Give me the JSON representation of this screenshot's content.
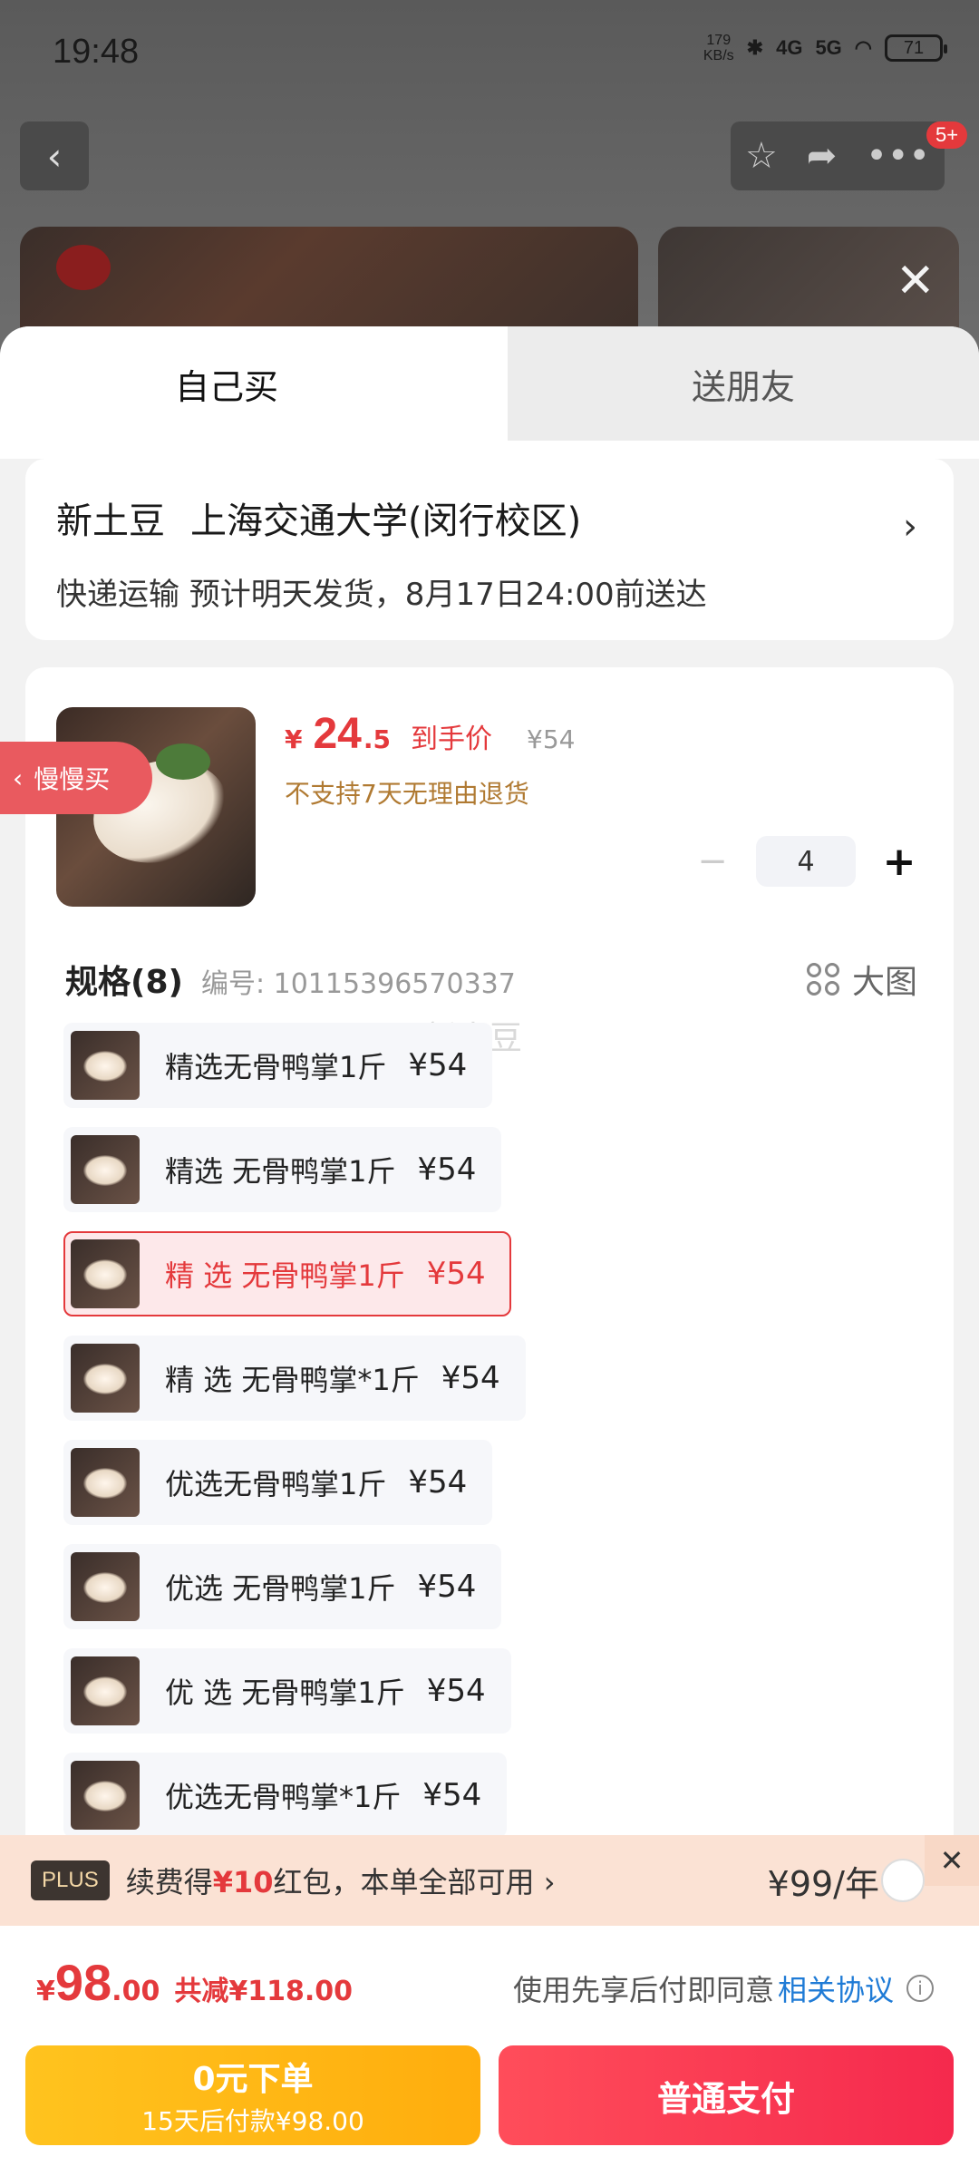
{
  "status": {
    "time": "19:48",
    "net_speed_value": "179",
    "net_speed_unit": "KB/s",
    "sig4g": "4G",
    "sig5g": "5G",
    "battery": "71"
  },
  "topbar": {
    "badge": "5+"
  },
  "tabs": {
    "self": "自己买",
    "friend": "送朋友"
  },
  "address": {
    "name": "新土豆",
    "school": "上海交通大学(闵行校区)",
    "delivery": "快递运输 预计明天发货，8月17日24:00前送达",
    "arrow": "›"
  },
  "product": {
    "price_symbol": "¥",
    "price_int": "24",
    "price_dec": ".5",
    "price_label": "到手价",
    "orig_price": "¥54",
    "notice": "不支持7天无理由退货",
    "qty": "4",
    "qty_minus": "−",
    "qty_plus": "+"
  },
  "side_pill": {
    "label": "慢慢买"
  },
  "spec": {
    "title": "规格(8)",
    "number": "编号: 10115396570337",
    "big_view": "大图",
    "watermark": "新土豆",
    "items": [
      {
        "label": "精选无骨鸭掌1斤",
        "price": "¥54"
      },
      {
        "label": "精选 无骨鸭掌1斤",
        "price": "¥54"
      },
      {
        "label": "精 选 无骨鸭掌1斤",
        "price": "¥54"
      },
      {
        "label": "精 选 无骨鸭掌*1斤",
        "price": "¥54"
      },
      {
        "label": "优选无骨鸭掌1斤",
        "price": "¥54"
      },
      {
        "label": "优选 无骨鸭掌1斤",
        "price": "¥54"
      },
      {
        "label": "优 选 无骨鸭掌1斤",
        "price": "¥54"
      },
      {
        "label": "优选无骨鸭掌*1斤",
        "price": "¥54"
      }
    ]
  },
  "plus": {
    "tag": "PLUS",
    "text_pre": "续费得",
    "amount": "¥10",
    "text_post": "红包，本单全部可用 ›",
    "price": "¥99/年",
    "close": "✕"
  },
  "footer": {
    "total_sym": "¥",
    "total_int": "98",
    "total_dec": ".00",
    "saved": "共减¥118.00",
    "agree_pre": "使用先享后付即同意",
    "agree_link": "相关协议",
    "info": "i",
    "zero_title": "0元下单",
    "zero_sub": "15天后付款¥98.00",
    "pay": "普通支付"
  },
  "colors": {
    "accent": "#e4393c",
    "selected_bg": "#fde8ea",
    "zero_btn": "#ffb514",
    "pay_btn": "#f8374f",
    "link": "#1f7bd6"
  }
}
